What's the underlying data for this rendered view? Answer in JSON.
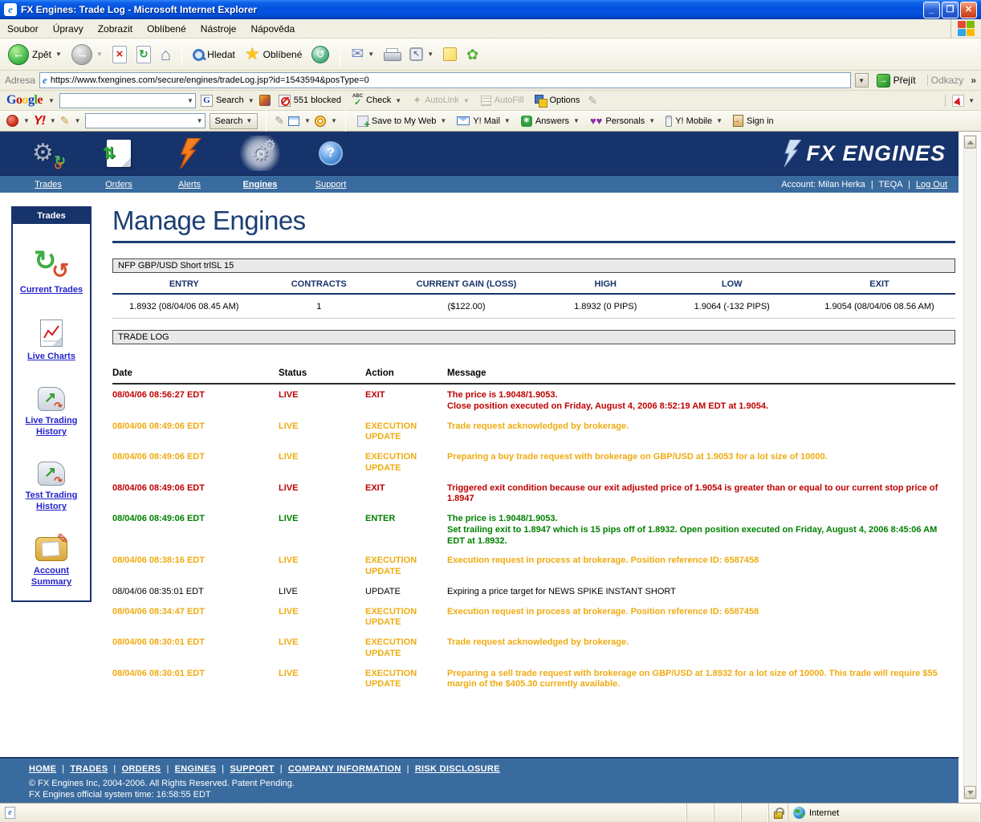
{
  "colors": {
    "navy": "#17336b",
    "steel_blue": "#3a6b9e",
    "log_red": "#c00000",
    "log_orange": "#efab11",
    "log_green": "#008000",
    "link_blue": "#2222cc",
    "titlebar_blue": "#0353e0"
  },
  "window": {
    "title": "FX Engines: Trade Log - Microsoft Internet Explorer"
  },
  "menubar": {
    "items": [
      "Soubor",
      "Úpravy",
      "Zobrazit",
      "Oblíbené",
      "Nástroje",
      "Nápověda"
    ]
  },
  "toolbar": {
    "back_label": "Zpět",
    "search_label": "Hledat",
    "favorites_label": "Oblíbené"
  },
  "addressbar": {
    "label": "Adresa",
    "url": "https://www.fxengines.com/secure/engines/tradeLog.jsp?id=1543594&posType=0",
    "go_label": "Přejít",
    "links_label": "Odkazy",
    "links_chevron": "»"
  },
  "google_toolbar": {
    "search_value": "",
    "search_label": "Search",
    "blocked_label": "551 blocked",
    "check_label": "Check",
    "autolink_label": "AutoLink",
    "autofill_label": "AutoFill",
    "options_label": "Options"
  },
  "yahoo_toolbar": {
    "logo": "Y!",
    "search_value": "",
    "search_label": "Search",
    "save_label": "Save to My Web",
    "mail_label": "Y! Mail",
    "answers_label": "Answers",
    "personals_label": "Personals",
    "mobile_label": "Y! Mobile",
    "signin_label": "Sign in"
  },
  "site_header": {
    "logo_text": "FX ENGINES",
    "nav": [
      {
        "label": "Trades"
      },
      {
        "label": "Orders"
      },
      {
        "label": "Alerts"
      },
      {
        "label": "Engines"
      },
      {
        "label": "Support"
      }
    ],
    "account_prefix": "Account:",
    "account_name": "Milan Herka",
    "account_org": "TEQA",
    "logout_label": "Log Out"
  },
  "sidebar": {
    "title": "Trades",
    "items": [
      {
        "label": "Current Trades"
      },
      {
        "label": "Live Charts"
      },
      {
        "label": "Live Trading History"
      },
      {
        "label": "Test Trading History"
      },
      {
        "label": "Account Summary"
      }
    ]
  },
  "main": {
    "heading": "Manage Engines",
    "position_panel": {
      "title": "NFP GBP/USD Short trlSL 15",
      "columns": [
        "ENTRY",
        "CONTRACTS",
        "CURRENT GAIN (LOSS)",
        "HIGH",
        "LOW",
        "EXIT"
      ],
      "row": [
        "1.8932 (08/04/06 08.45 AM)",
        "1",
        "($122.00)",
        "1.8932 (0 PIPS)",
        "1.9064 (-132 PIPS)",
        "1.9054 (08/04/06 08.56 AM)"
      ]
    },
    "trade_log": {
      "title": "TRADE LOG",
      "columns": [
        "Date",
        "Status",
        "Action",
        "Message"
      ],
      "rows": [
        {
          "date": "08/04/06 08:56:27 EDT",
          "status": "LIVE",
          "action": "EXIT",
          "tone": "red",
          "message": "The price is 1.9048/1.9053.\nClose position executed on Friday, August 4, 2006 8:52:19 AM EDT at 1.9054."
        },
        {
          "date": "08/04/06 08:49:06 EDT",
          "status": "LIVE",
          "action": "EXECUTION UPDATE",
          "tone": "orange",
          "message": "Trade request acknowledged by brokerage."
        },
        {
          "date": "08/04/06 08:49:06 EDT",
          "status": "LIVE",
          "action": "EXECUTION UPDATE",
          "tone": "orange",
          "message": "Preparing a buy trade request with brokerage on GBP/USD at 1.9053 for a lot size of 10000."
        },
        {
          "date": "08/04/06 08:49:06 EDT",
          "status": "LIVE",
          "action": "EXIT",
          "tone": "red",
          "message": "Triggered exit condition because our exit adjusted price of 1.9054 is greater than or equal to our current stop price of 1.8947"
        },
        {
          "date": "08/04/06 08:49:06 EDT",
          "status": "LIVE",
          "action": "ENTER",
          "tone": "green",
          "message": "The price is 1.9048/1.9053.\nSet trailing exit to 1.8947 which is 15 pips off of 1.8932. Open position executed on Friday, August 4, 2006 8:45:06 AM EDT at 1.8932."
        },
        {
          "date": "08/04/06 08:38:16 EDT",
          "status": "LIVE",
          "action": "EXECUTION UPDATE",
          "tone": "orange",
          "message": "Execution request in process at brokerage. Position reference ID: 6587458"
        },
        {
          "date": "08/04/06 08:35:01 EDT",
          "status": "LIVE",
          "action": "UPDATE",
          "tone": "plain",
          "message": "Expiring a price target for NEWS SPIKE INSTANT SHORT"
        },
        {
          "date": "08/04/06 08:34:47 EDT",
          "status": "LIVE",
          "action": "EXECUTION UPDATE",
          "tone": "orange",
          "message": "Execution request in process at brokerage. Position reference ID: 6587458"
        },
        {
          "date": "08/04/06 08:30:01 EDT",
          "status": "LIVE",
          "action": "EXECUTION UPDATE",
          "tone": "orange",
          "message": "Trade request acknowledged by brokerage."
        },
        {
          "date": "08/04/06 08:30:01 EDT",
          "status": "LIVE",
          "action": "EXECUTION UPDATE",
          "tone": "orange",
          "message": "Preparing a sell trade request with brokerage on GBP/USD at 1.8932 for a lot size of 10000. This trade will require $55 margin of the $405.30 currently available."
        }
      ]
    }
  },
  "footer": {
    "links": [
      "HOME",
      "TRADES",
      "ORDERS",
      "ENGINES",
      "SUPPORT",
      "COMPANY INFORMATION",
      "RISK DISCLOSURE"
    ],
    "copyright": "© FX Engines Inc, 2004-2006. All Rights Reserved. Patent Pending.",
    "system_time": "FX Engines official system time: 16:58:55 EDT"
  },
  "statusbar": {
    "zone_label": "Internet"
  }
}
